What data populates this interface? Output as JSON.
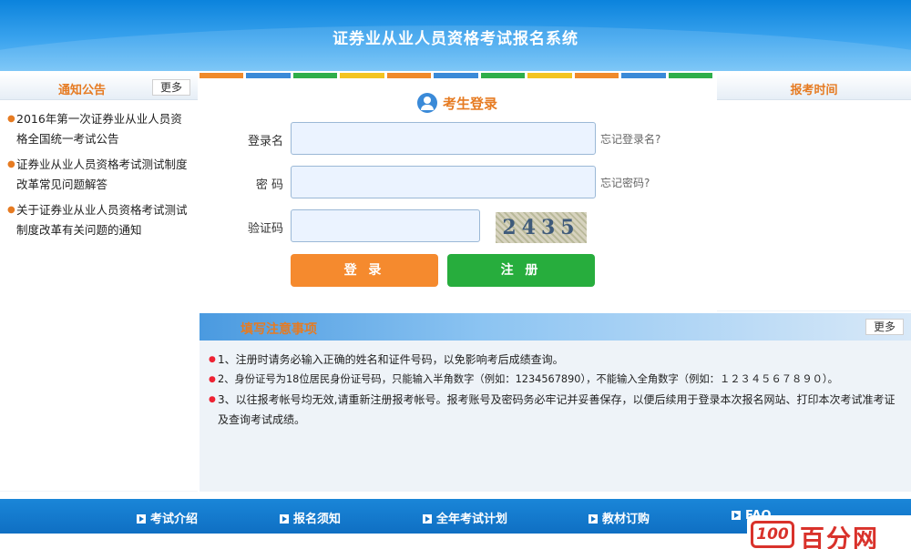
{
  "header": {
    "title": "证券业从业人员资格考试报名系统"
  },
  "left_panel": {
    "title": "通知公告",
    "more_label": "更多",
    "notices": [
      "2016年第一次证券业从业人员资格全国统一考试公告",
      "证券业从业人员资格考试测试制度改革常见问题解答",
      "关于证券业从业人员资格考试测试制度改革有关问题的通知"
    ]
  },
  "right_panel": {
    "title": "报考时间"
  },
  "login": {
    "title": "考生登录",
    "username_label": "登录名",
    "username_value": "",
    "forgot_username": "忘记登录名?",
    "password_label": "密 码",
    "password_value": "",
    "forgot_password": "忘记密码?",
    "captcha_label": "验证码",
    "captcha_value": "",
    "captcha_text": "2435",
    "login_button": "登 录",
    "register_button": "注 册"
  },
  "notes": {
    "title": "填写注意事项",
    "more_label": "更多",
    "items": [
      "1、注册时请务必输入正确的姓名和证件号码，以免影响考后成绩查询。",
      "2、身份证号为18位居民身份证号码，只能输入半角数字（例如：1234567890），不能输入全角数字（例如：１２３４５６７８９０）。",
      "3、以往报考帐号均无效,请重新注册报考帐号。报考账号及密码务必牢记并妥善保存，以便后续用于登录本次报名网站、打印本次考试准考证及查询考试成绩。"
    ]
  },
  "footer": {
    "nav": [
      "考试介绍",
      "报名须知",
      "全年考试计划",
      "教材订购",
      "FAQ"
    ]
  },
  "watermark": {
    "logo": "100",
    "text": "百分网"
  },
  "colors": {
    "header_blue": "#0b83dc",
    "accent_orange": "#e67b22",
    "login_orange": "#f58a2e",
    "register_green": "#27ad3d",
    "colorbar": [
      "#f08a2a",
      "#3a8ad8",
      "#2fae4a",
      "#f3c421",
      "#f08a2a",
      "#3a8ad8",
      "#2fae4a",
      "#f3c421",
      "#f08a2a",
      "#3a8ad8",
      "#2fae4a"
    ]
  }
}
